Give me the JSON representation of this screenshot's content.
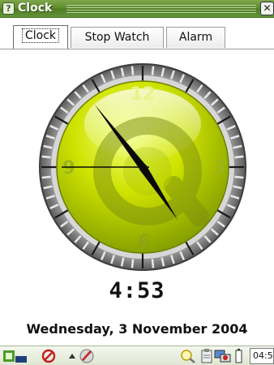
{
  "window": {
    "title": "Clock",
    "title_icon": "help-icon",
    "close_icon": "close-icon",
    "close_glyph": "✕"
  },
  "tabs": [
    {
      "label": "Clock",
      "active": true
    },
    {
      "label": "Stop Watch",
      "active": false
    },
    {
      "label": "Alarm",
      "active": false
    }
  ],
  "clock": {
    "face_numbers": {
      "top": "12",
      "right": "3",
      "bottom": "6",
      "left": "9"
    },
    "hour": 4,
    "minute": 53,
    "second": 45,
    "face_color": "#c4de00",
    "rim_color": "#bdbdbd"
  },
  "digital_time": "4:53",
  "date_text": "Wednesday, 3 November 2004",
  "taskbar": {
    "launcher_icon": "qtopia-launcher-icon",
    "tray_icons": [
      "no-entry-icon",
      "up-arrow-icon",
      "pen-icon",
      "magnifier-icon",
      "clipboard-icon",
      "network-icon",
      "battery-icon"
    ],
    "time": "04:5"
  }
}
